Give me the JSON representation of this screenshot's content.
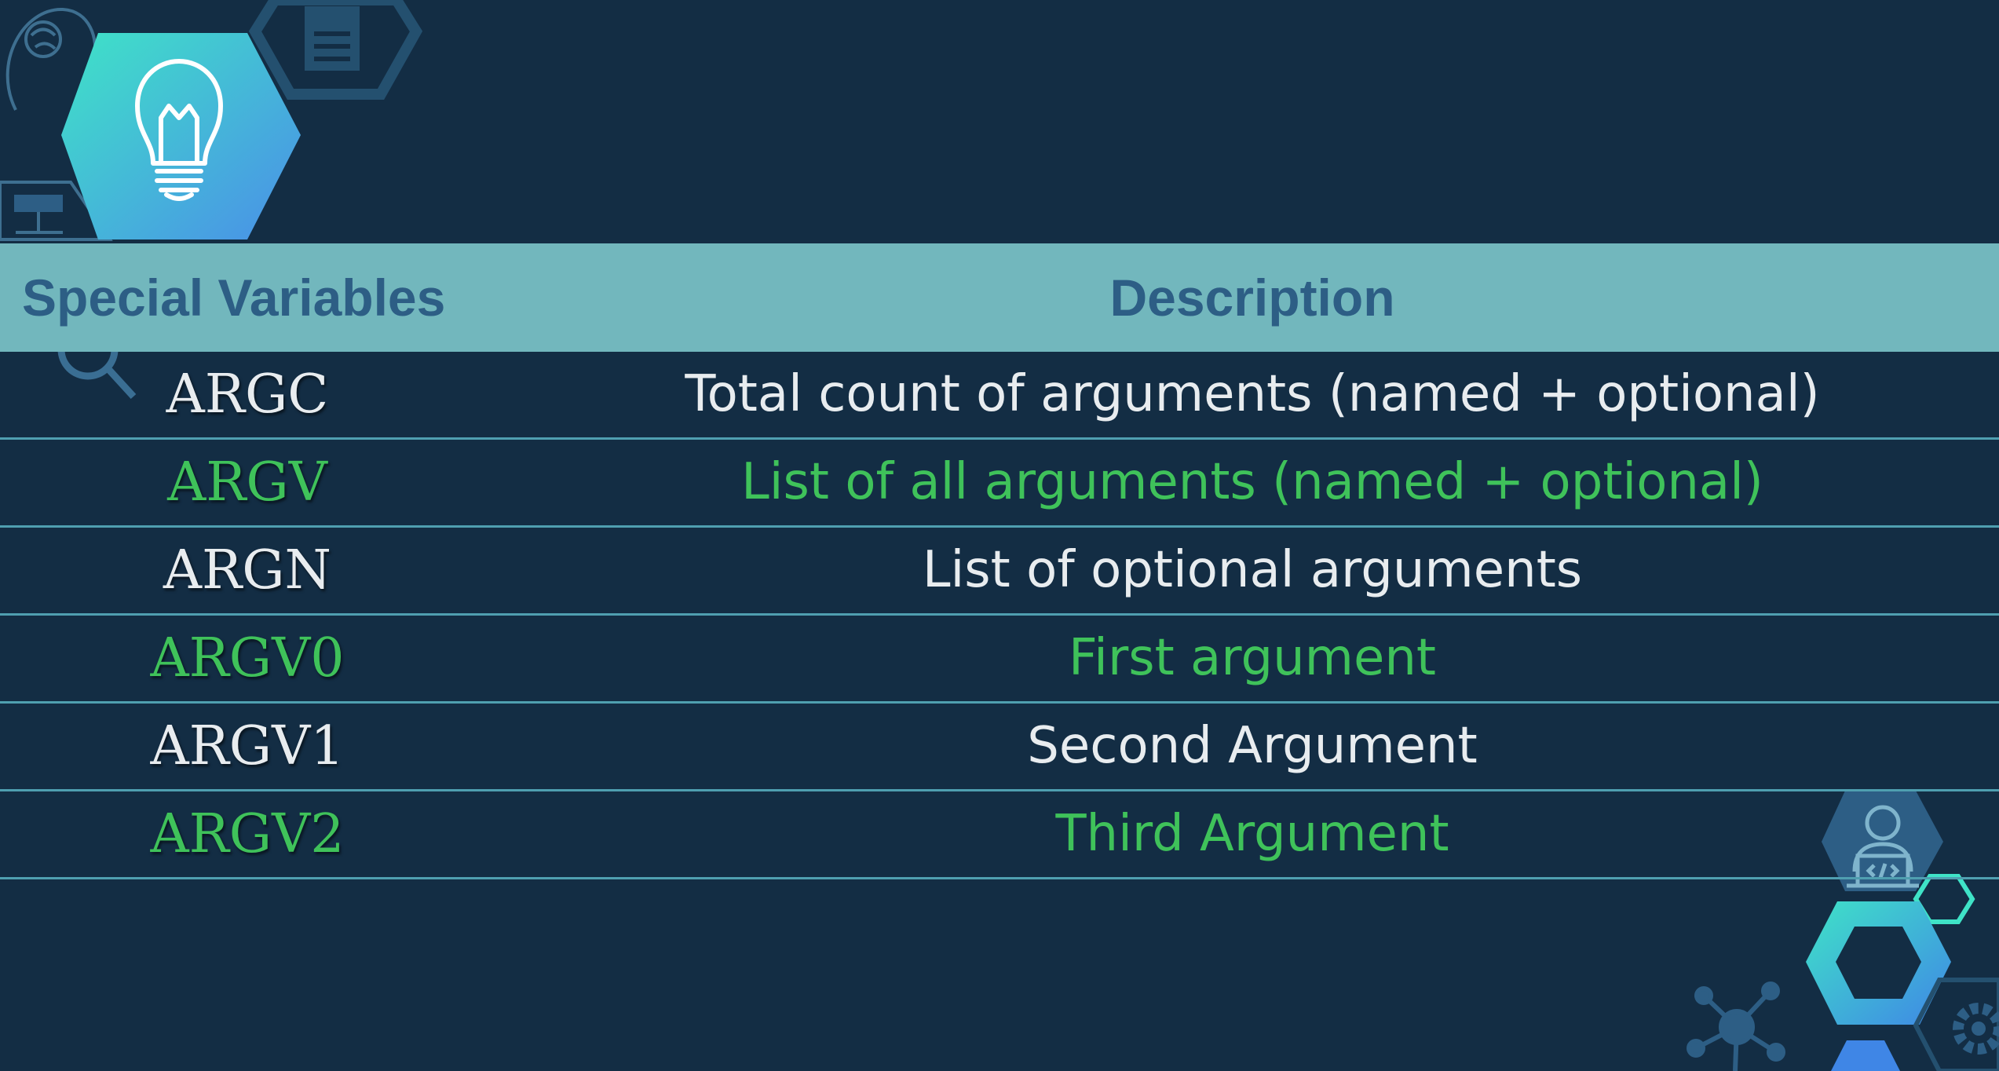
{
  "table": {
    "headers": {
      "variable": "Special Variables",
      "description": "Description"
    },
    "rows": [
      {
        "variable": "ARGC",
        "description": "Total count of arguments (named + optional)",
        "color": "white"
      },
      {
        "variable": "ARGV",
        "description": "List of all arguments (named + optional)",
        "color": "green"
      },
      {
        "variable": "ARGN",
        "description": "List of optional arguments",
        "color": "white"
      },
      {
        "variable": "ARGV0",
        "description": "First argument",
        "color": "green"
      },
      {
        "variable": "ARGV1",
        "description": "Second Argument",
        "color": "white"
      },
      {
        "variable": "ARGV2",
        "description": "Third Argument",
        "color": "green"
      }
    ]
  },
  "colors": {
    "background": "#132d44",
    "header_band": "#72b7bd",
    "header_text": "#2d5e85",
    "white_text": "#e8ecef",
    "green_text": "#3fc25a",
    "row_divider": "#4f9fb0"
  },
  "icons": [
    "brain-head-icon",
    "document-icon",
    "lightbulb-icon",
    "flowchart-icon",
    "magnifier-icon",
    "developer-laptop-icon",
    "network-icon",
    "gear-icon"
  ]
}
